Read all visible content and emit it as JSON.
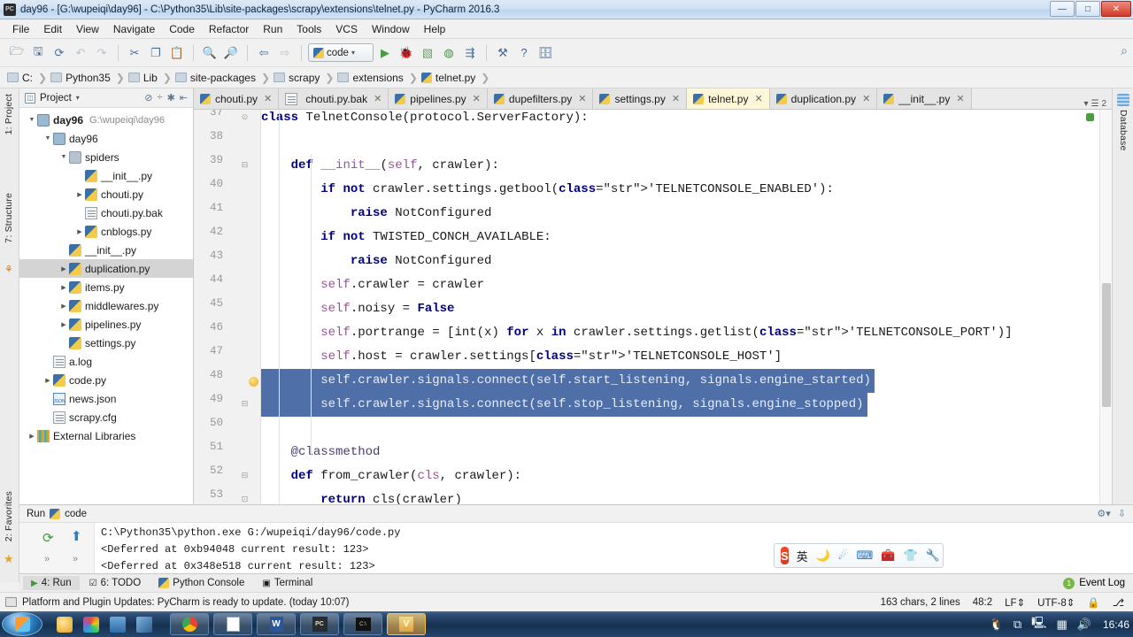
{
  "window": {
    "title": "day96 - [G:\\wupeiqi\\day96] - C:\\Python35\\Lib\\site-packages\\scrapy\\extensions\\telnet.py - PyCharm 2016.3",
    "app_icon": "PC",
    "minimize": "—",
    "maximize": "□",
    "close": "✕"
  },
  "menubar": {
    "items": [
      "File",
      "Edit",
      "View",
      "Navigate",
      "Code",
      "Refactor",
      "Run",
      "Tools",
      "VCS",
      "Window",
      "Help"
    ]
  },
  "toolbar": {
    "run_config": "code",
    "icons": [
      "open-folder-icon",
      "save-all-icon",
      "sync-icon",
      "undo-icon",
      "redo-icon",
      "cut-icon",
      "copy-icon",
      "paste-icon",
      "find-icon",
      "replace-icon",
      "back-icon",
      "forward-icon"
    ],
    "run_icons": [
      "run-icon",
      "debug-icon",
      "coverage-icon",
      "profile-icon",
      "run-with-icon",
      "settings-wrench-icon",
      "help-icon",
      "updates-icon"
    ],
    "search_icon": "⌕"
  },
  "breadcrumb": {
    "items": [
      "C:",
      "Python35",
      "Lib",
      "site-packages",
      "scrapy",
      "extensions",
      "telnet.py"
    ],
    "separator": "❯"
  },
  "left_strip": {
    "project": "1: Project",
    "structure": "7: Structure",
    "favorites": "2: Favorites"
  },
  "right_strip": {
    "database": "Database"
  },
  "project_panel": {
    "title": "Project",
    "caret": "▾",
    "tools": [
      "collapse-icon",
      "split-icon",
      "settings-icon",
      "locate-icon"
    ],
    "tree": [
      {
        "indent": 0,
        "arrow": "▼",
        "icon": "folder-blue",
        "label": "day96",
        "bold": true,
        "path": "G:\\wupeiqi\\day96",
        "selected": false
      },
      {
        "indent": 1,
        "arrow": "▼",
        "icon": "folder-blue",
        "label": "day96",
        "bold": false,
        "path": "",
        "selected": false
      },
      {
        "indent": 2,
        "arrow": "▼",
        "icon": "folder",
        "label": "spiders",
        "bold": false,
        "path": "",
        "selected": false
      },
      {
        "indent": 3,
        "arrow": "",
        "icon": "py",
        "label": "__init__.py",
        "bold": false,
        "path": "",
        "selected": false
      },
      {
        "indent": 3,
        "arrow": "▶",
        "icon": "py",
        "label": "chouti.py",
        "bold": false,
        "path": "",
        "selected": false
      },
      {
        "indent": 3,
        "arrow": "",
        "icon": "txt",
        "label": "chouti.py.bak",
        "bold": false,
        "path": "",
        "selected": false
      },
      {
        "indent": 3,
        "arrow": "▶",
        "icon": "py",
        "label": "cnblogs.py",
        "bold": false,
        "path": "",
        "selected": false
      },
      {
        "indent": 2,
        "arrow": "",
        "icon": "py",
        "label": "__init__.py",
        "bold": false,
        "path": "",
        "selected": false
      },
      {
        "indent": 2,
        "arrow": "▶",
        "icon": "py",
        "label": "duplication.py",
        "bold": false,
        "path": "",
        "selected": true
      },
      {
        "indent": 2,
        "arrow": "▶",
        "icon": "py",
        "label": "items.py",
        "bold": false,
        "path": "",
        "selected": false
      },
      {
        "indent": 2,
        "arrow": "▶",
        "icon": "py",
        "label": "middlewares.py",
        "bold": false,
        "path": "",
        "selected": false
      },
      {
        "indent": 2,
        "arrow": "▶",
        "icon": "py",
        "label": "pipelines.py",
        "bold": false,
        "path": "",
        "selected": false
      },
      {
        "indent": 2,
        "arrow": "",
        "icon": "py",
        "label": "settings.py",
        "bold": false,
        "path": "",
        "selected": false
      },
      {
        "indent": 1,
        "arrow": "",
        "icon": "txt",
        "label": "a.log",
        "bold": false,
        "path": "",
        "selected": false
      },
      {
        "indent": 1,
        "arrow": "▶",
        "icon": "py",
        "label": "code.py",
        "bold": false,
        "path": "",
        "selected": false
      },
      {
        "indent": 1,
        "arrow": "",
        "icon": "json",
        "label": "news.json",
        "bold": false,
        "path": "",
        "selected": false
      },
      {
        "indent": 1,
        "arrow": "",
        "icon": "txt",
        "label": "scrapy.cfg",
        "bold": false,
        "path": "",
        "selected": false
      },
      {
        "indent": 0,
        "arrow": "▶",
        "icon": "lib",
        "label": "External Libraries",
        "bold": false,
        "path": "",
        "selected": false
      }
    ]
  },
  "editor_tabs": {
    "close_glyph": "✕",
    "overflow_caret": "▾",
    "overflow_count": "2",
    "items": [
      {
        "label": "chouti.py",
        "icon": "py-file-icon",
        "active": false
      },
      {
        "label": "chouti.py.bak",
        "icon": "text-file-icon",
        "active": false
      },
      {
        "label": "pipelines.py",
        "icon": "py-file-icon",
        "active": false
      },
      {
        "label": "dupefilters.py",
        "icon": "py-file-icon",
        "active": false
      },
      {
        "label": "settings.py",
        "icon": "py-file-icon",
        "active": false
      },
      {
        "label": "telnet.py",
        "icon": "py-file-icon",
        "active": true
      },
      {
        "label": "duplication.py",
        "icon": "py-file-icon",
        "active": false
      },
      {
        "label": "__init__.py",
        "icon": "py-file-icon",
        "active": false
      }
    ]
  },
  "editor": {
    "first_line_number": 37,
    "highlight_lines": [
      48,
      49
    ],
    "lines": [
      {
        "n": 37,
        "text": "class TelnetConsole(protocol.ServerFactory):"
      },
      {
        "n": 38,
        "text": ""
      },
      {
        "n": 39,
        "text": "    def __init__(self, crawler):"
      },
      {
        "n": 40,
        "text": "        if not crawler.settings.getbool('TELNETCONSOLE_ENABLED'):"
      },
      {
        "n": 41,
        "text": "            raise NotConfigured"
      },
      {
        "n": 42,
        "text": "        if not TWISTED_CONCH_AVAILABLE:"
      },
      {
        "n": 43,
        "text": "            raise NotConfigured"
      },
      {
        "n": 44,
        "text": "        self.crawler = crawler"
      },
      {
        "n": 45,
        "text": "        self.noisy = False"
      },
      {
        "n": 46,
        "text": "        self.portrange = [int(x) for x in crawler.settings.getlist('TELNETCONSOLE_PORT')]"
      },
      {
        "n": 47,
        "text": "        self.host = crawler.settings['TELNETCONSOLE_HOST']"
      },
      {
        "n": 48,
        "text": "        self.crawler.signals.connect(self.start_listening, signals.engine_started)"
      },
      {
        "n": 49,
        "text": "        self.crawler.signals.connect(self.stop_listening, signals.engine_stopped)"
      },
      {
        "n": 50,
        "text": ""
      },
      {
        "n": 51,
        "text": "    @classmethod"
      },
      {
        "n": 52,
        "text": "    def from_crawler(cls, crawler):"
      },
      {
        "n": 53,
        "text": "        return cls(crawler)"
      }
    ]
  },
  "run_window": {
    "title": "Run",
    "config_name": "code",
    "console_lines": [
      "C:\\Python35\\python.exe G:/wupeiqi/day96/code.py",
      "<Deferred at 0xb94048 current result: 123>",
      "<Deferred at 0x348e518 current result: 123>"
    ],
    "gutter_icons": [
      "rerun-icon",
      "scroll-up-icon",
      "soft-wrap-icon",
      "print-icon"
    ],
    "header_icons": [
      "settings-icon",
      "hide-icon"
    ]
  },
  "ime_bar": {
    "logo": "S",
    "mode": "英",
    "icons": [
      "moon-icon",
      "weather-icon",
      "keyboard-icon",
      "toolbox-icon",
      "skin-icon",
      "wrench-icon"
    ]
  },
  "bottom_tabs": {
    "items": [
      {
        "label": "4: Run",
        "icon": "run-icon",
        "active": true
      },
      {
        "label": "6: TODO",
        "icon": "todo-icon",
        "active": false
      },
      {
        "label": "Python Console",
        "icon": "python-console-icon",
        "active": false
      },
      {
        "label": "Terminal",
        "icon": "terminal-icon",
        "active": false
      }
    ],
    "event_log": "Event Log",
    "event_log_count": "1"
  },
  "status_bar": {
    "message": "Platform and Plugin Updates: PyCharm is ready to update. (today 10:07)",
    "chars": "163 chars, 2 lines",
    "caret": "48:2",
    "line_sep": "LF",
    "encoding": "UTF-8",
    "lock_icon": "lock-icon",
    "branch_icon": "branch-icon"
  },
  "taskbar": {
    "start_label": "start-button",
    "quick_launch": [
      "media-player-icon",
      "paint-icon",
      "save-icon",
      "tool-icon"
    ],
    "buttons": [
      "chrome-window",
      "notepad-window",
      "word-window",
      "pycharm-window",
      "cmd-window",
      "editor-window"
    ],
    "tray": [
      "qq-icon",
      "network-icon",
      "monitor-icon",
      "excel-icon",
      "volume-icon"
    ],
    "clock": "16:46"
  }
}
